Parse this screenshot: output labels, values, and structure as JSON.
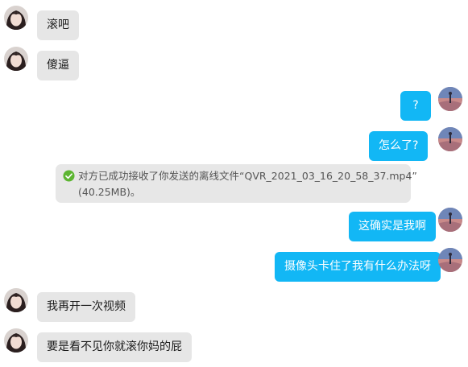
{
  "colors": {
    "incoming_bubble": "#e6e6e6",
    "outgoing_bubble": "#12b7f5",
    "notice_background": "#e7e7e7",
    "success_check": "#5cb531"
  },
  "messages": [
    {
      "side": "left",
      "avatar": "contact-avatar",
      "text": "滚吧"
    },
    {
      "side": "left",
      "avatar": "contact-avatar",
      "text": "傻逼"
    },
    {
      "side": "right",
      "avatar": "self-avatar",
      "text": "?"
    },
    {
      "side": "right",
      "avatar": "self-avatar",
      "text": "怎么了?"
    },
    {
      "side": "right",
      "avatar": "self-avatar",
      "text": "这确实是我啊"
    },
    {
      "side": "right",
      "avatar": "self-avatar",
      "text": "摄像头卡住了我有什么办法呀"
    },
    {
      "side": "left",
      "avatar": "contact-avatar",
      "text": "我再开一次视频"
    },
    {
      "side": "left",
      "avatar": "contact-avatar",
      "text": "要是看不见你就滚你妈的屁"
    }
  ],
  "file_notice": {
    "icon": "check-circle-icon",
    "line1": "对方已成功接收了你发送的离线文件“QVR_2021_03_16_20_58_37.mp4”",
    "line2": "(40.25MB)。"
  }
}
